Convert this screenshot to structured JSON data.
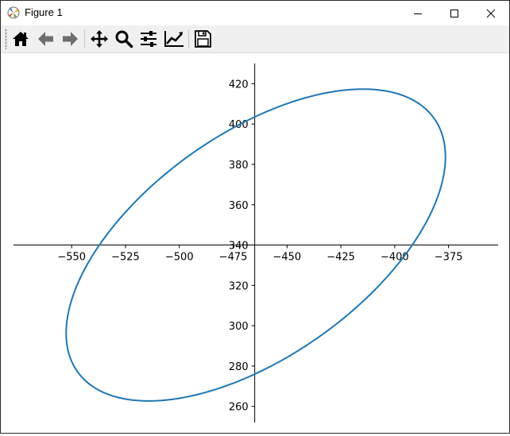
{
  "window": {
    "title": "Figure 1",
    "controls": [
      "minimize",
      "maximize",
      "close"
    ]
  },
  "toolbar": {
    "buttons": [
      {
        "name": "home",
        "icon": "home-icon"
      },
      {
        "name": "back",
        "icon": "back-arrow-icon"
      },
      {
        "name": "forward",
        "icon": "forward-arrow-icon"
      },
      {
        "name": "pan",
        "icon": "move-icon"
      },
      {
        "name": "zoom",
        "icon": "magnifier-icon"
      },
      {
        "name": "configure-subplots",
        "icon": "sliders-icon"
      },
      {
        "name": "edit-axis",
        "icon": "line-chart-icon"
      },
      {
        "name": "save",
        "icon": "floppy-disk-icon"
      }
    ]
  },
  "chart_data": {
    "type": "line",
    "title": "",
    "xlabel": "",
    "ylabel": "",
    "xlim": [
      -577,
      -352
    ],
    "ylim": [
      252,
      430
    ],
    "spines": "centered",
    "x_axis_position_y": 340,
    "y_axis_position_x": -465,
    "xticks": [
      -550,
      -525,
      -500,
      -475,
      -450,
      -425,
      -400,
      -375
    ],
    "yticks": [
      260,
      280,
      300,
      320,
      340,
      360,
      380,
      400,
      420
    ],
    "line_color": "#1f77b4",
    "grid": false,
    "series": [
      {
        "kind": "ellipse",
        "center": [
          -464.5,
          340
        ],
        "semi_axes": [
          104,
          54
        ],
        "rotation_deg": 38.5
      }
    ]
  }
}
